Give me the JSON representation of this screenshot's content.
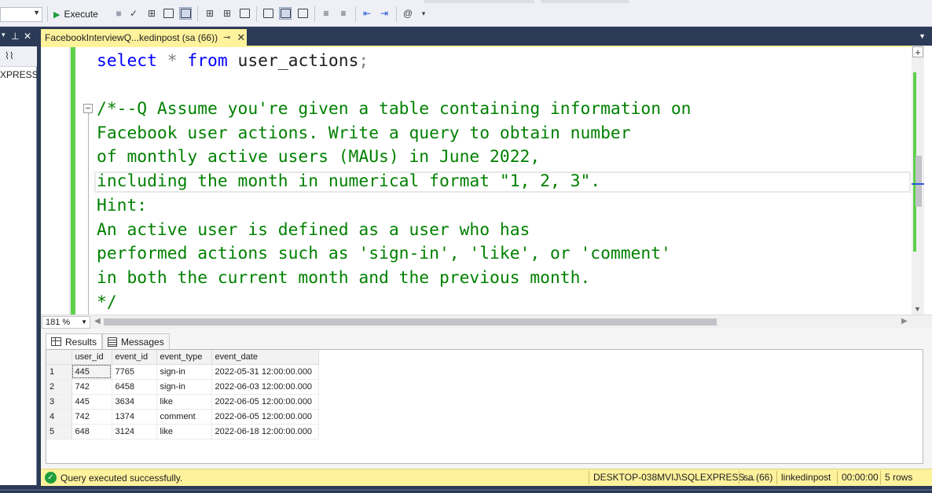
{
  "toolbar": {
    "execute_label": "Execute",
    "database_selector_value": ""
  },
  "object_explorer": {
    "pin_glyph": "▾ ⊣ ✕",
    "node_label": "XPRESS"
  },
  "document_tab": {
    "title": "FacebookInterviewQ...kedinpost (sa (66))"
  },
  "editor": {
    "lines": [
      {
        "kw1": "select",
        "op1": " * ",
        "kw2": "from",
        "rest": " user_actions",
        "semi": ";"
      },
      {
        "comment": "/*--Q Assume you're given a table containing information on"
      },
      {
        "comment": "Facebook user actions. Write a query to obtain number"
      },
      {
        "comment": "of monthly active users (MAUs) in June 2022,"
      },
      {
        "comment": "including the month in numerical format \"1, 2, 3\"."
      },
      {
        "comment": "Hint:"
      },
      {
        "comment": "An active user is defined as a user who has"
      },
      {
        "comment": "performed actions such as 'sign-in', 'like', or 'comment'"
      },
      {
        "comment": "in both the current month and the previous month."
      },
      {
        "comment": "*/"
      }
    ]
  },
  "zoom": {
    "value": "181 %"
  },
  "results": {
    "tabs": [
      {
        "label": "Results",
        "icon": "grid-icon",
        "active": true
      },
      {
        "label": "Messages",
        "icon": "messages-icon",
        "active": false
      }
    ],
    "columns": [
      "user_id",
      "event_id",
      "event_type",
      "event_date"
    ],
    "rows": [
      {
        "num": "1",
        "cells": [
          "445",
          "7765",
          "sign-in",
          "2022-05-31 12:00:00.000"
        ]
      },
      {
        "num": "2",
        "cells": [
          "742",
          "6458",
          "sign-in",
          "2022-06-03 12:00:00.000"
        ]
      },
      {
        "num": "3",
        "cells": [
          "445",
          "3634",
          "like",
          "2022-06-05 12:00:00.000"
        ]
      },
      {
        "num": "4",
        "cells": [
          "742",
          "1374",
          "comment",
          "2022-06-05 12:00:00.000"
        ]
      },
      {
        "num": "5",
        "cells": [
          "648",
          "3124",
          "like",
          "2022-06-18 12:00:00.000"
        ]
      }
    ]
  },
  "status_bar": {
    "message": "Query executed successfully.",
    "server": "DESKTOP-038MVIJ\\SQLEXPRESS ...",
    "login": "sa (66)",
    "database": "linkedinpost",
    "elapsed": "00:00:00",
    "row_count": "5 rows"
  },
  "colors": {
    "keyword": "#0000ff",
    "comment": "#008000",
    "operator": "#808080",
    "tab_accent": "#fff29d",
    "chrome_dark": "#2b3a56",
    "success_green": "#1f9e3c"
  }
}
